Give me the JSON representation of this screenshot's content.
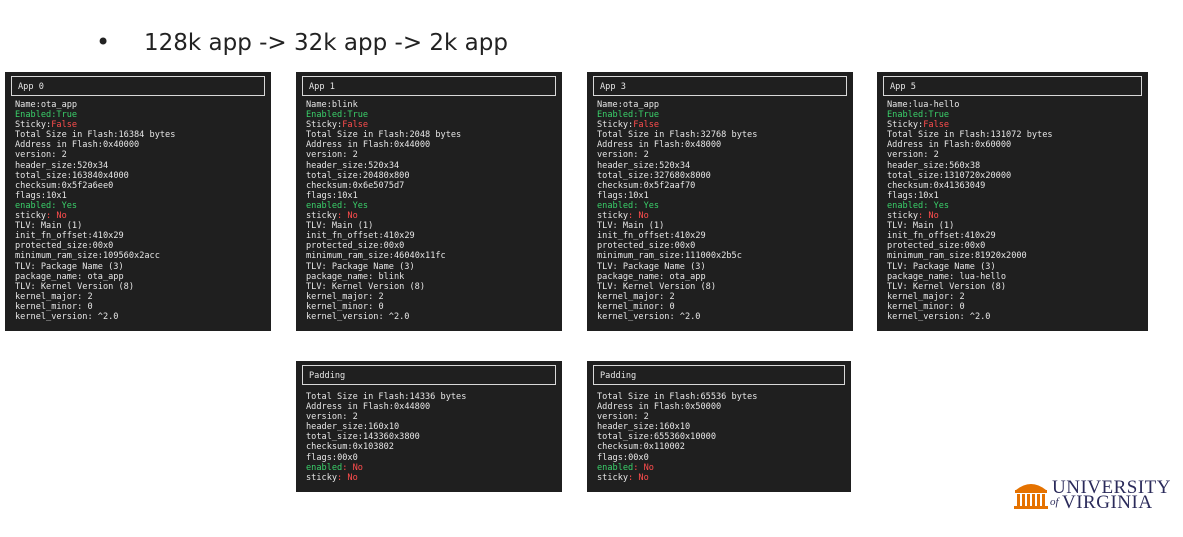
{
  "bullet": {
    "dot": "•",
    "text": "128k app -> 32k app -> 2k app"
  },
  "apps": [
    {
      "title": "App 0",
      "name": "ota_app",
      "enabled": "True",
      "sticky": "False",
      "total_size": "16384 bytes",
      "address": "0x40000",
      "version": ": 2",
      "header_size": [
        "52",
        "0x34"
      ],
      "total_size2": [
        "16384",
        "0x4000"
      ],
      "checksum": "0x5f2a6ee0",
      "flags": [
        "1",
        "0x1"
      ],
      "f_enabled": ": Yes",
      "f_sticky": ": No",
      "init_fn_offset": [
        "41",
        "0x29"
      ],
      "protected_size": [
        "0",
        "0x0"
      ],
      "minimum_ram_size": [
        "10956",
        "0x2acc"
      ],
      "package_name": ": ota_app",
      "kernel_major": ": 2",
      "kernel_minor": ": 0",
      "kernel_version": ": ^2.0"
    },
    {
      "title": "App 1",
      "name": "blink",
      "enabled": "True",
      "sticky": "False",
      "total_size": "2048 bytes",
      "address": "0x44000",
      "version": ": 2",
      "header_size": [
        "52",
        "0x34"
      ],
      "total_size2": [
        "2048",
        "0x800"
      ],
      "checksum": "0x6e5075d7",
      "flags": [
        "1",
        "0x1"
      ],
      "f_enabled": ": Yes",
      "f_sticky": ": No",
      "init_fn_offset": [
        "41",
        "0x29"
      ],
      "protected_size": [
        "0",
        "0x0"
      ],
      "minimum_ram_size": [
        "4604",
        "0x11fc"
      ],
      "package_name": ": blink",
      "kernel_major": ": 2",
      "kernel_minor": ": 0",
      "kernel_version": ": ^2.0"
    },
    {
      "title": "App 3",
      "name": "ota_app",
      "enabled": "True",
      "sticky": "False",
      "total_size": "32768 bytes",
      "address": "0x48000",
      "version": ": 2",
      "header_size": [
        "52",
        "0x34"
      ],
      "total_size2": [
        "32768",
        "0x8000"
      ],
      "checksum": "0x5f2aaf70",
      "flags": [
        "1",
        "0x1"
      ],
      "f_enabled": ": Yes",
      "f_sticky": ": No",
      "init_fn_offset": [
        "41",
        "0x29"
      ],
      "protected_size": [
        "0",
        "0x0"
      ],
      "minimum_ram_size": [
        "11100",
        "0x2b5c"
      ],
      "package_name": ": ota_app",
      "kernel_major": ": 2",
      "kernel_minor": ": 0",
      "kernel_version": ": ^2.0"
    },
    {
      "title": "App 5",
      "name": "lua-hello",
      "enabled": "True",
      "sticky": "False",
      "total_size": "131072 bytes",
      "address": "0x60000",
      "version": ": 2",
      "header_size": [
        "56",
        "0x38"
      ],
      "total_size2": [
        "131072",
        "0x20000"
      ],
      "checksum": "0x41363049",
      "flags": [
        "1",
        "0x1"
      ],
      "f_enabled": ": Yes",
      "f_sticky": ": No",
      "init_fn_offset": [
        "41",
        "0x29"
      ],
      "protected_size": [
        "0",
        "0x0"
      ],
      "minimum_ram_size": [
        "8192",
        "0x2000"
      ],
      "package_name": ": lua-hello",
      "kernel_major": ": 2",
      "kernel_minor": ": 0",
      "kernel_version": ": ^2.0"
    }
  ],
  "paddings": [
    {
      "title": "Padding",
      "total_size": "14336 bytes",
      "address": "0x44800",
      "version": ": 2",
      "header_size": [
        "16",
        "0x10"
      ],
      "total_size2": [
        "14336",
        "0x3800"
      ],
      "checksum": "0x103802",
      "flags": [
        "0",
        "0x0"
      ],
      "f_enabled": ": No",
      "f_sticky": ": No"
    },
    {
      "title": "Padding",
      "total_size": "65536 bytes",
      "address": "0x50000",
      "version": ": 2",
      "header_size": [
        "16",
        "0x10"
      ],
      "total_size2": [
        "65536",
        "0x10000"
      ],
      "checksum": "0x110002",
      "flags": [
        "0",
        "0x0"
      ],
      "f_enabled": ": No",
      "f_sticky": ": No"
    }
  ],
  "labels": {
    "name": "Name:",
    "enabled": "Enabled:",
    "sticky": "Sticky:",
    "total_size_flash": "Total Size in Flash:",
    "address_flash": "Address in Flash:",
    "version": "version",
    "header_size": "header_size",
    "total_size": "total_size",
    "checksum": "checksum",
    "flags": "flags",
    "f_enabled": "enabled",
    "f_sticky": "sticky",
    "tlv_main": "TLV: Main (1)",
    "init_fn_offset": "init_fn_offset",
    "protected_size": "protected_size",
    "minimum_ram_size": "minimum_ram_size",
    "tlv_pkg": "TLV: Package Name (3)",
    "package_name": "package_name",
    "tlv_kernel": "TLV: Kernel Version (8)",
    "kernel_major": "kernel_major",
    "kernel_minor": "kernel_minor",
    "kernel_version": "kernel_version",
    "colon": ":"
  },
  "logo": {
    "line1": "UNIVERSITY",
    "line2": "VIRGINIA",
    "prefix": "of",
    "color": "#2b2b5b",
    "accent": "#e57200"
  }
}
